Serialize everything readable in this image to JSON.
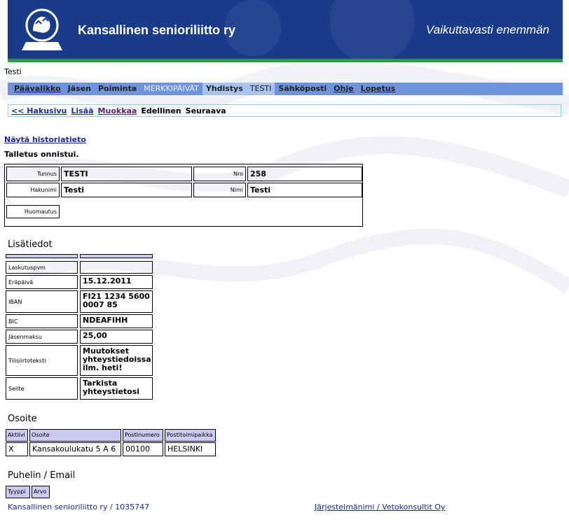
{
  "header": {
    "org_name": "Kansallinen senioriliitto ry",
    "slogan": "Vaikuttavasti enemmän",
    "logo_icon": "lion-crest-icon",
    "colors": {
      "header_blue": "#1a3a8a",
      "stripe_green": "#2e9a47",
      "menu_blue": "#6f93dd"
    }
  },
  "username": "Testi",
  "menu": {
    "items": [
      {
        "label": "Päävalikko"
      },
      {
        "label": "Jäsen"
      },
      {
        "label": "Poiminta"
      },
      {
        "label": "MERKKIPÄIVÄT"
      },
      {
        "label": "Yhdistys"
      },
      {
        "label": "TESTI"
      },
      {
        "label": "Sähköposti"
      },
      {
        "label": "Ohje"
      },
      {
        "label": "Lopetus"
      }
    ]
  },
  "subnav": {
    "back": "<< Hakusivu",
    "add": "Lisää",
    "edit": "Muokkaa",
    "prev": "Edellinen",
    "next": "Seuraava"
  },
  "history_link": "Näytä historiatieto",
  "status_message": "Talletus onnistui.",
  "record": {
    "tunnus_label": "Tunnus",
    "tunnus_value": "TESTI",
    "nro_label": "Nro",
    "nro_value": "258",
    "hakunimi_label": "Hakunimi",
    "hakunimi_value": "Testi",
    "nimi_label": "Nimi",
    "nimi_value": "Testi",
    "huomautus_label": "Huomautus"
  },
  "lisatiedot": {
    "title": "Lisätiedot",
    "rows": [
      {
        "label": "Laskutuspvm",
        "value": ""
      },
      {
        "label": "Eräpäivä",
        "value": "15.12.2011"
      },
      {
        "label": "IBAN",
        "value": "FI21 1234 5600 0007 85"
      },
      {
        "label": "BIC",
        "value": "NDEAFIHH"
      },
      {
        "label": "Jäsenmaksu",
        "value": "25,00"
      },
      {
        "label": "Tilisiirtoteksti",
        "value": "Muutokset yhteystiedoissa ilm. heti!"
      },
      {
        "label": "Selite",
        "value": "Tarkista yhteystietosi"
      }
    ]
  },
  "osoite": {
    "title": "Osoite",
    "headers": [
      "Aktiivi",
      "Osoite",
      "Postinumero",
      "Postitoimipaikka"
    ],
    "rows": [
      [
        "X",
        "Kansakoulukatu 5 A 6",
        "00100",
        "HELSINKI"
      ]
    ]
  },
  "puhelin": {
    "title": "Puhelin / Email",
    "headers": [
      "Tyyppi",
      "Arvo"
    ]
  },
  "footer": {
    "left": "Kansallinen senioriliitto ry / 1035747",
    "right": "Järjestelmänimi / Vetokonsultit Oy"
  }
}
